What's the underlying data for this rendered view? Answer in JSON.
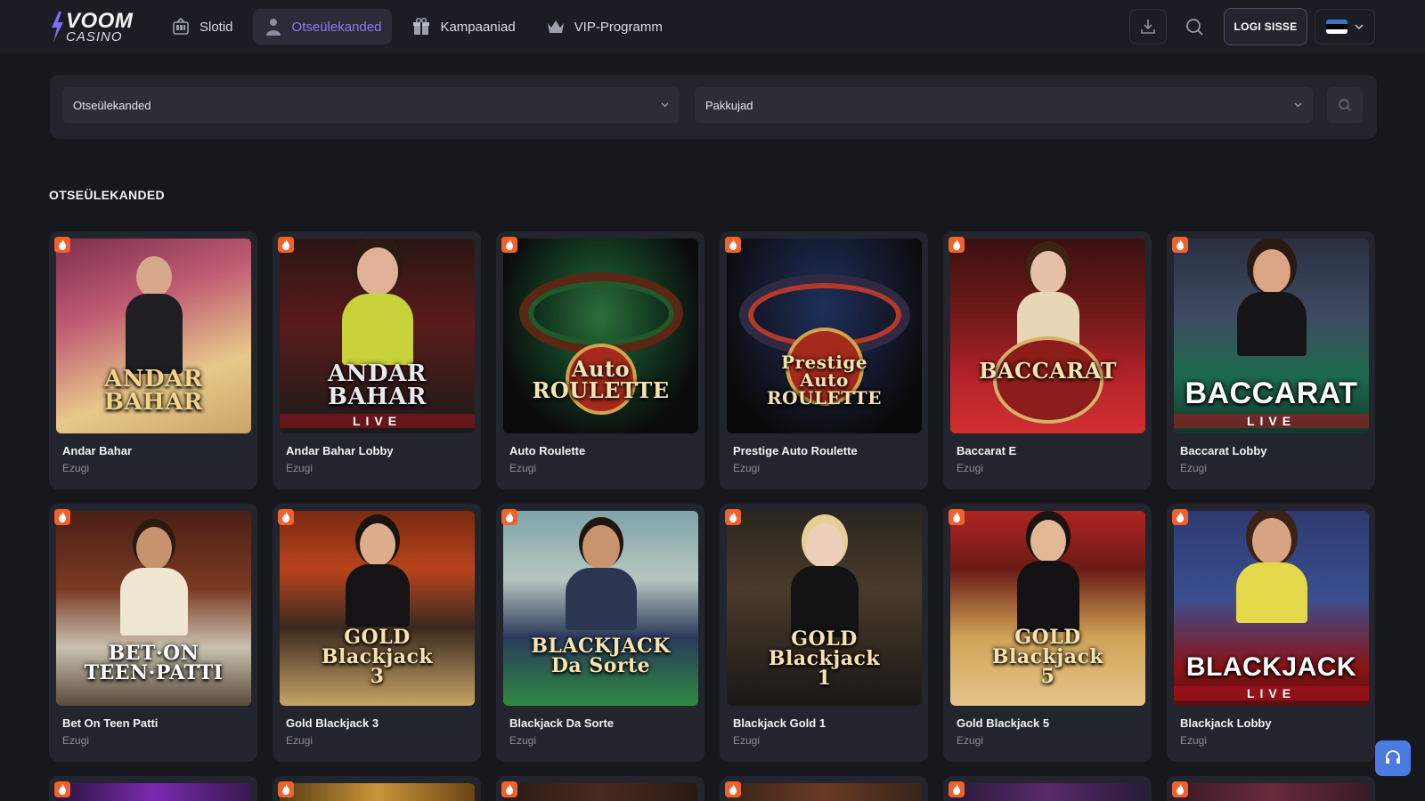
{
  "header": {
    "logo_primary": "VOOM",
    "logo_secondary": "CASINO",
    "nav": [
      {
        "label": "Slotid",
        "icon": "slot-machine-icon",
        "active": false
      },
      {
        "label": "Otseülekanded",
        "icon": "live-dealer-icon",
        "active": true
      },
      {
        "label": "Kampaaniad",
        "icon": "gift-icon",
        "active": false
      },
      {
        "label": "VIP-Programm",
        "icon": "crown-icon",
        "active": false
      }
    ],
    "download_icon": "download-icon",
    "search_icon": "search-icon",
    "login_label": "LOGI SISSE",
    "language_icon": "estonian-flag-icon"
  },
  "filters": {
    "category_value": "Otseülekanded",
    "provider_value": "Pakkujad"
  },
  "section_title": "OTSEÜLEKANDED",
  "games": [
    {
      "name": "Andar Bahar",
      "provider": "Ezugi",
      "thumb_text": "ANDAR\nBAHAR",
      "live": ""
    },
    {
      "name": "Andar Bahar Lobby",
      "provider": "Ezugi",
      "thumb_text": "ANDAR\nBAHAR",
      "live": "LIVE"
    },
    {
      "name": "Auto Roulette",
      "provider": "Ezugi",
      "thumb_text": "Auto\nROULETTE",
      "live": ""
    },
    {
      "name": "Prestige Auto Roulette",
      "provider": "Ezugi",
      "thumb_text": "Prestige\nAuto\nROULETTE",
      "live": ""
    },
    {
      "name": "Baccarat E",
      "provider": "Ezugi",
      "thumb_text": "BACCARAT",
      "live": ""
    },
    {
      "name": "Baccarat Lobby",
      "provider": "Ezugi",
      "thumb_text": "BACCARAT",
      "live": "LIVE"
    },
    {
      "name": "Bet On Teen Patti",
      "provider": "Ezugi",
      "thumb_text": "BET·ON\nTEEN·PATTI",
      "live": ""
    },
    {
      "name": "Gold Blackjack 3",
      "provider": "Ezugi",
      "thumb_text": "GOLD\nBlackjack\n3",
      "live": ""
    },
    {
      "name": "Blackjack Da Sorte",
      "provider": "Ezugi",
      "thumb_text": "BLACKJACK\nDa Sorte",
      "live": ""
    },
    {
      "name": "Blackjack Gold 1",
      "provider": "Ezugi",
      "thumb_text": "GOLD\nBlackjack\n1",
      "live": ""
    },
    {
      "name": "Gold Blackjack 5",
      "provider": "Ezugi",
      "thumb_text": "GOLD\nBlackjack\n5",
      "live": ""
    },
    {
      "name": "Blackjack Lobby",
      "provider": "Ezugi",
      "thumb_text": "BLACKJACK",
      "live": "LIVE"
    }
  ],
  "support_icon": "headset-icon",
  "colors": {
    "background": "#16181e",
    "card": "#22252d",
    "accent": "#8b7cf0",
    "hot_badge": "#f0622d",
    "support": "#4b7be0"
  }
}
